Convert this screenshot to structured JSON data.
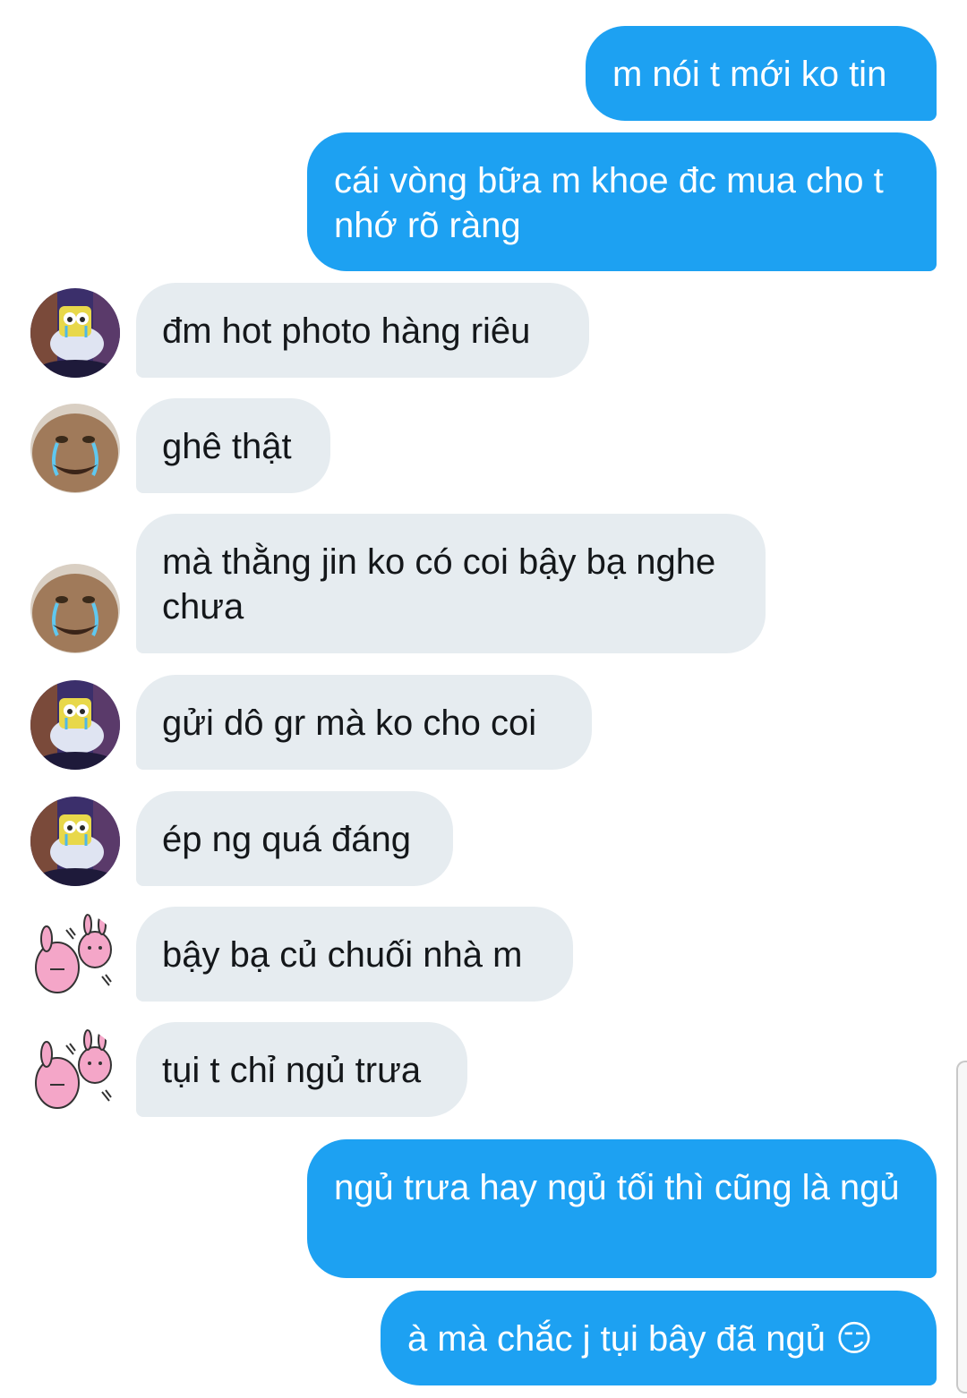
{
  "messages": [
    {
      "sender": "me",
      "text": "m nói t mới ko tin"
    },
    {
      "sender": "me",
      "text": "cái vòng bữa m khoe đc mua cho t nhớ rõ ràng"
    },
    {
      "sender": "spongebob",
      "text": "đm hot photo hàng riêu"
    },
    {
      "sender": "crying-face",
      "text": "ghê thật"
    },
    {
      "sender": "crying-face",
      "text": "mà thằng jin ko có coi bậy bạ nghe chưa"
    },
    {
      "sender": "spongebob",
      "text": "gửi dô gr mà ko cho coi"
    },
    {
      "sender": "spongebob",
      "text": "ép ng quá đáng"
    },
    {
      "sender": "pink-bunny",
      "text": "bậy bạ củ chuối nhà m"
    },
    {
      "sender": "pink-bunny",
      "text": "tụi t chỉ ngủ trưa"
    },
    {
      "sender": "me",
      "text": "ngủ trưa hay ngủ tối thì cũng là ngủ"
    },
    {
      "sender": "me",
      "text": "à mà chắc j tụi bây đã ngủ 😏"
    }
  ],
  "colors": {
    "sent_bubble": "#1da1f2",
    "received_bubble": "#e6ecf0",
    "sent_text": "#ffffff",
    "received_text": "#14171a"
  }
}
